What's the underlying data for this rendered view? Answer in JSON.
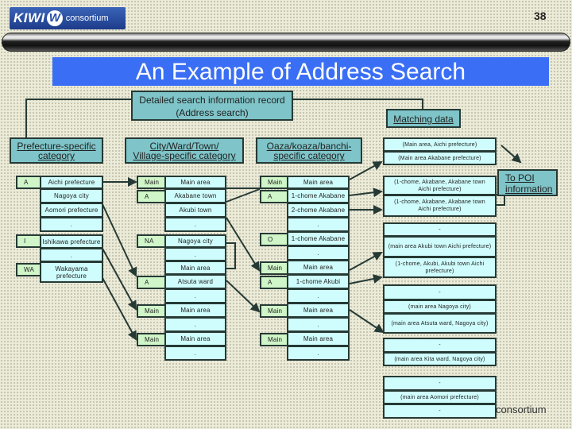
{
  "header": {
    "logo": {
      "brand": "KIWI",
      "mark": "W",
      "suffix": "consortium"
    },
    "page_number": "38",
    "title": "An Example of Address Search"
  },
  "diagram": {
    "root": {
      "line1": "Detailed search information record",
      "line2": "(Address search)"
    },
    "matching_data": "Matching data",
    "to_poi": {
      "line1": "To POI",
      "line2": "information"
    },
    "categories": {
      "prefecture": {
        "line1": "Prefecture-specific",
        "line2": "category"
      },
      "city": {
        "line1": "City/Ward/Town/",
        "line2": "Village-specific category"
      },
      "oaza": {
        "line1": "Oaza/koaza/banchi-",
        "line2": "specific category"
      }
    },
    "prefecture_table": [
      {
        "code": "A",
        "values": [
          "Aichi prefecture",
          "Nagoya city",
          "Aomori prefecture",
          "."
        ]
      },
      {
        "code": "I",
        "values": [
          "Ishikawa prefecture",
          "."
        ]
      },
      {
        "code": "WA",
        "values": [
          "Wakayama prefecture"
        ]
      }
    ],
    "city_table": [
      {
        "code": "Main",
        "value": "Main area"
      },
      {
        "code": "A",
        "value": "Akabane town"
      },
      {
        "code": "",
        "value": "Akubi town"
      },
      {
        "code": "",
        "value": "."
      },
      {
        "code": "NA",
        "value": "Nagoya city"
      },
      {
        "code": "",
        "value": "."
      },
      {
        "code": "",
        "value": "Main area"
      },
      {
        "code": "A",
        "value": "Atsuta ward"
      },
      {
        "code": "",
        "value": "."
      },
      {
        "code": "Main",
        "value": "Main area"
      },
      {
        "code": "",
        "value": "."
      },
      {
        "code": "Main",
        "value": "Main area"
      },
      {
        "code": "",
        "value": "."
      }
    ],
    "oaza_table": [
      {
        "code": "Main",
        "value": "Main area"
      },
      {
        "code": "A",
        "value": "1-chome Akabane"
      },
      {
        "code": "",
        "value": "2-chome Akabane"
      },
      {
        "code": "",
        "value": "."
      },
      {
        "code": "O",
        "value": "1-chome Akabane"
      },
      {
        "code": "",
        "value": "."
      },
      {
        "code": "Main",
        "value": "Main area"
      },
      {
        "code": "A",
        "value": "1-chome Akubi"
      },
      {
        "code": "",
        "value": "."
      },
      {
        "code": "Main",
        "value": "Main area"
      },
      {
        "code": "",
        "value": "."
      },
      {
        "code": "Main",
        "value": "Main area"
      },
      {
        "code": "",
        "value": "."
      }
    ],
    "matching_groups": [
      [
        "(Main area, Aichi prefecture)",
        "(Main area Akabane prefecture)"
      ],
      [
        "(1-chome, Akabane, Akabane town Aichi prefecture)",
        "(1-chome, Akabane, Akabane town Aichi prefecture)"
      ],
      [
        "-",
        "(main area Akubi town Aichi prefecture)",
        "(1-chome, Akubi, Akubi town Aichi prefecture)"
      ],
      [
        "-",
        "(main area Nagoya city)",
        "(main area Atsuta ward, Nagoya city)"
      ],
      [
        "-",
        "(main area Kita ward, Nagoya city)"
      ],
      [
        "-",
        "(main area Aomori prefecture)",
        "-"
      ]
    ]
  },
  "footer": {
    "text": "consortium"
  }
}
